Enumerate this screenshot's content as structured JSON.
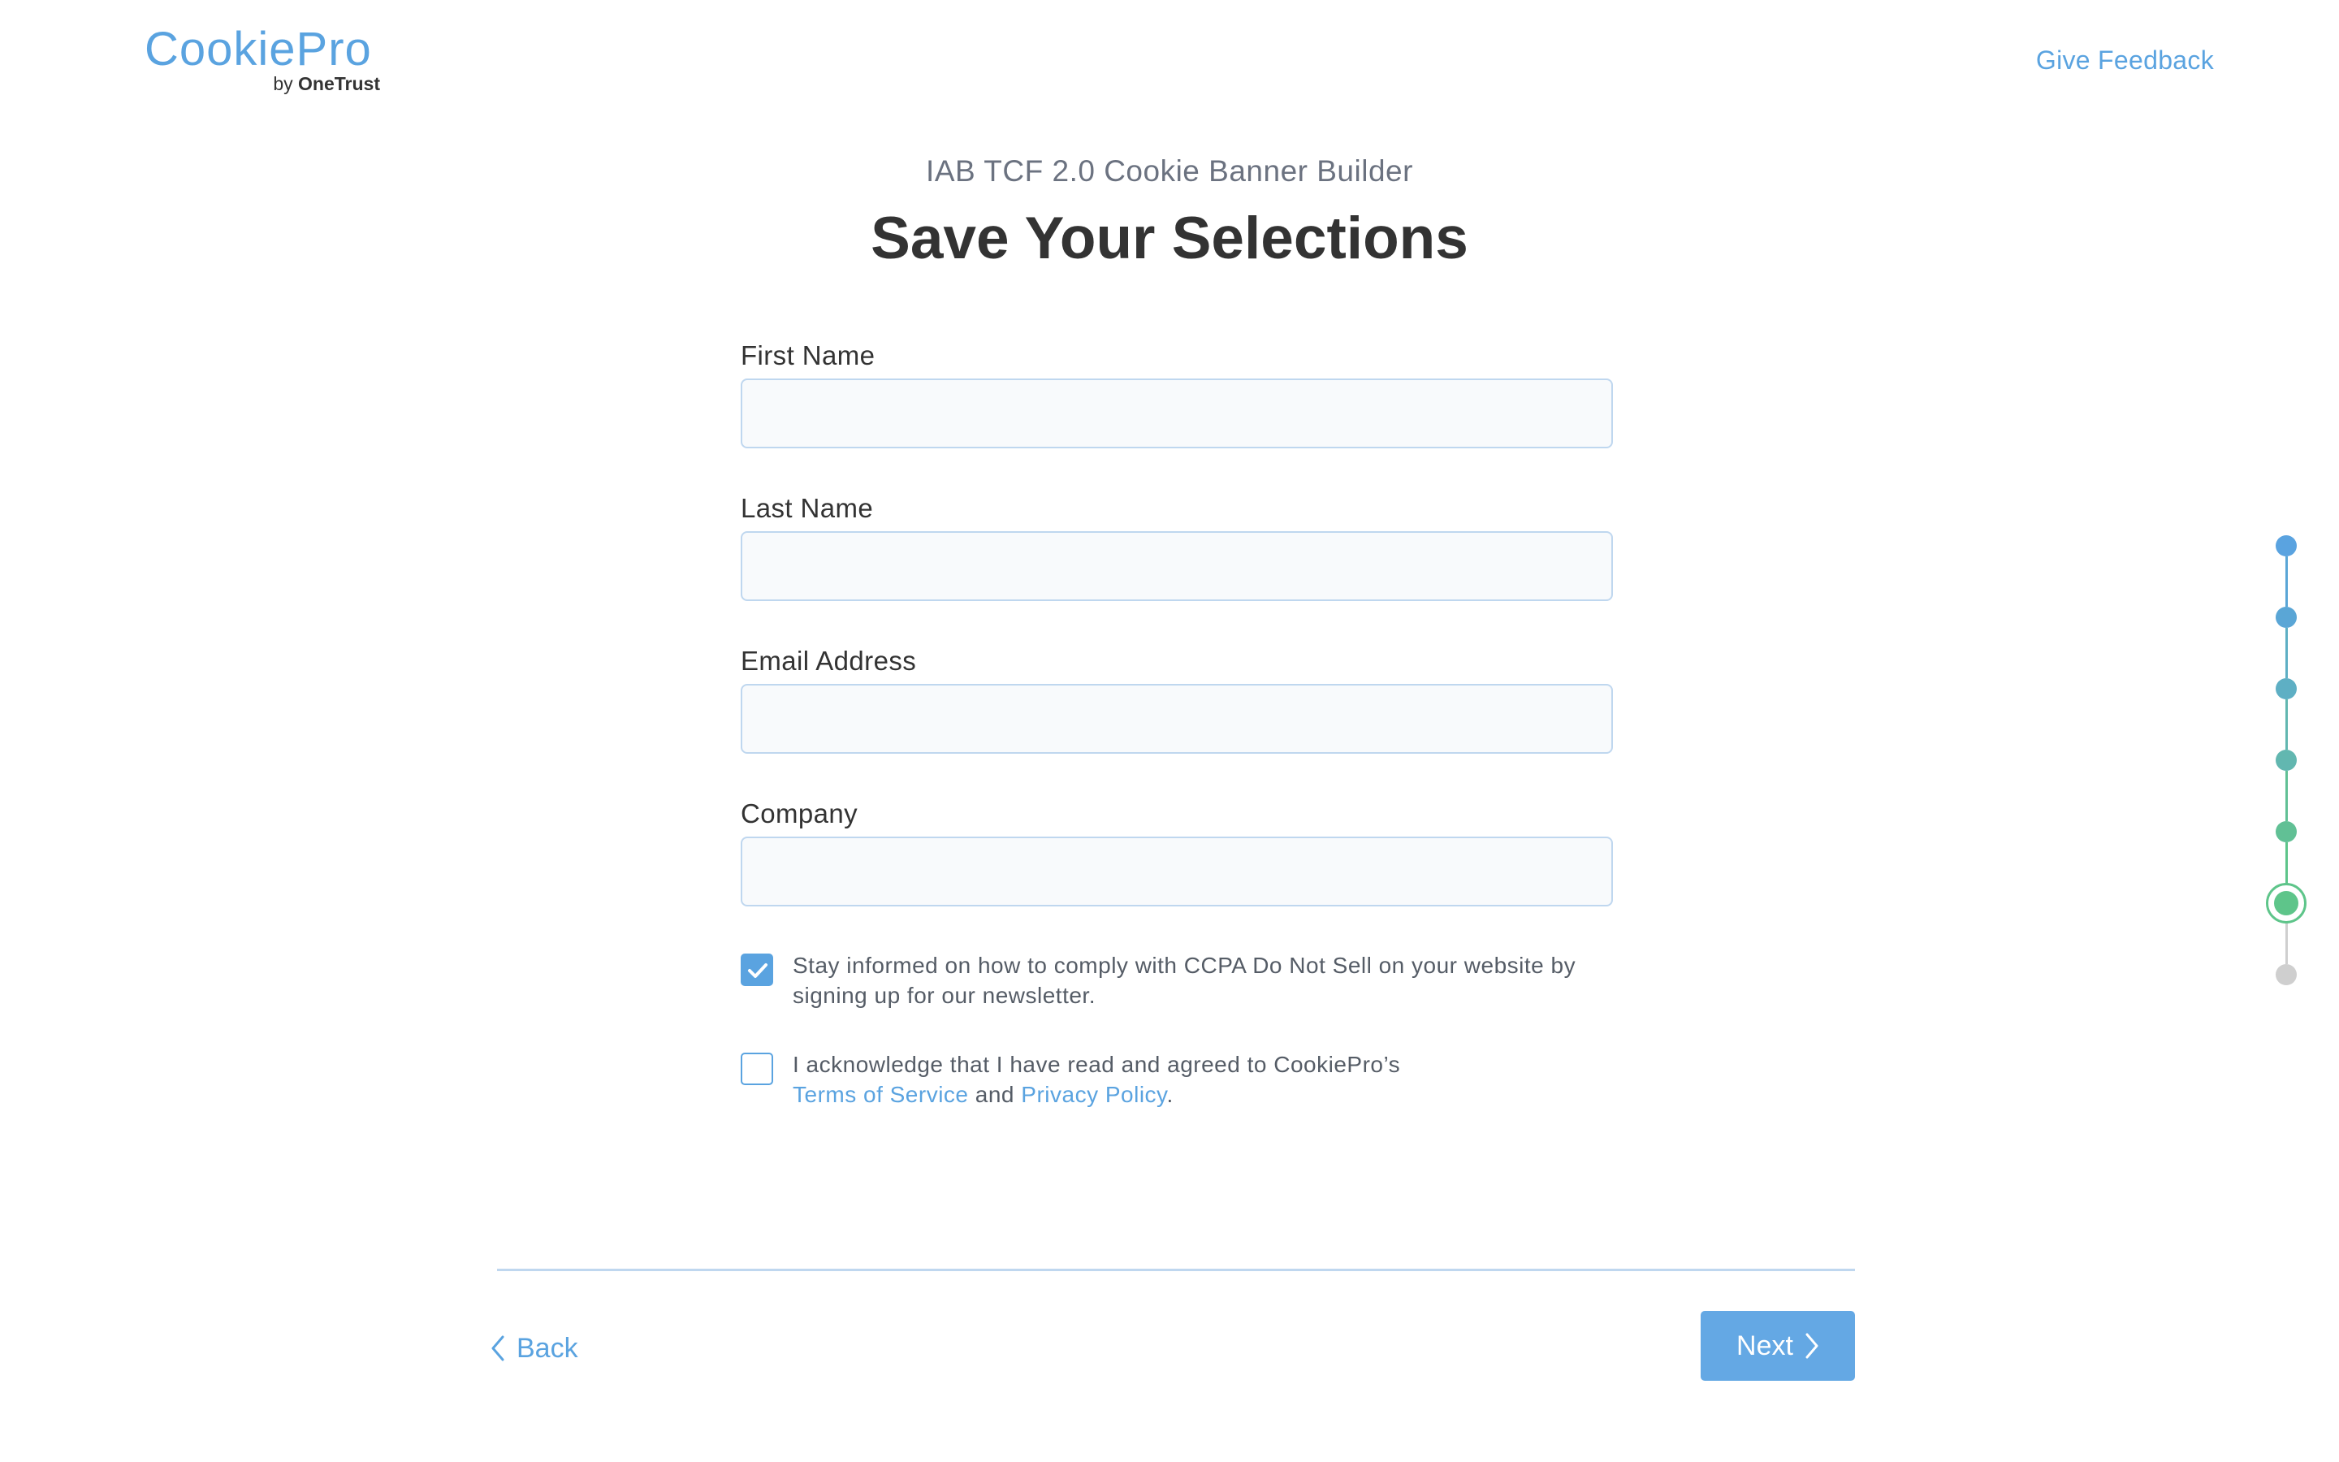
{
  "header": {
    "logo_main": "CookiePro",
    "logo_by": "by",
    "logo_company": "OneTrust",
    "feedback_label": "Give Feedback"
  },
  "main": {
    "subtitle": "IAB TCF 2.0 Cookie Banner Builder",
    "title": "Save Your Selections"
  },
  "form": {
    "fields": [
      {
        "label": "First Name",
        "value": "",
        "placeholder": ""
      },
      {
        "label": "Last Name",
        "value": "",
        "placeholder": ""
      },
      {
        "label": "Email Address",
        "value": "",
        "placeholder": ""
      },
      {
        "label": "Company",
        "value": "",
        "placeholder": ""
      }
    ],
    "newsletter": {
      "checked": true,
      "text": "Stay informed on how to comply with CCPA Do Not Sell on your website by signing up for our newsletter."
    },
    "terms": {
      "checked": false,
      "text_before": "I acknowledge that I have read and agreed to CookiePro’s",
      "terms_link": "Terms of Service",
      "and_text": "and",
      "privacy_link": "Privacy Policy",
      "period": "."
    }
  },
  "footer": {
    "back_label": "Back",
    "next_label": "Next"
  },
  "stepper": {
    "total_steps": 7,
    "current_step": 6,
    "step_colors": [
      "#5aa3e0",
      "#5aa6d6",
      "#5eafc4",
      "#62b7b0",
      "#61c095",
      "#5ec58a",
      "#cfcfcf"
    ],
    "current_ring_color": "#5ec58a"
  },
  "colors": {
    "accent": "#5aa3e0",
    "title_text": "#333333",
    "muted_text": "#6b7280",
    "input_border": "#bfd7ef",
    "input_background": "#f8fafc"
  },
  "icons": {
    "checkmark": "check-icon",
    "back": "chevron-left-icon",
    "next": "chevron-right-icon"
  }
}
